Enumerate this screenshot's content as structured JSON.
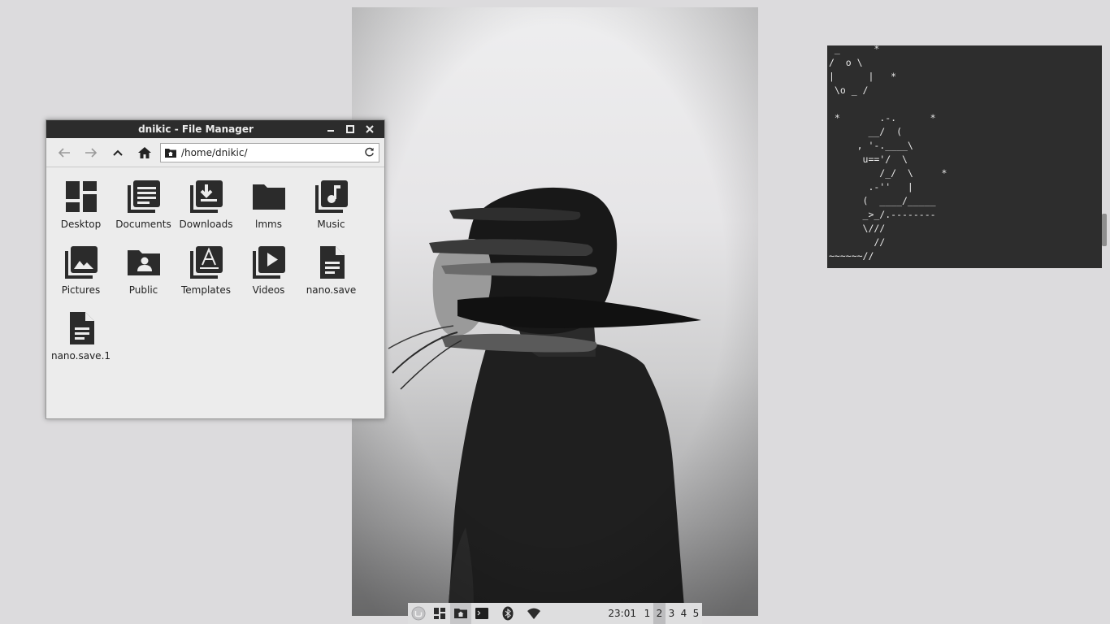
{
  "file_manager": {
    "title": "dnikic - File Manager",
    "path": "/home/dnikic/",
    "items": [
      {
        "label": "Desktop",
        "icon": "desktop-folder-icon"
      },
      {
        "label": "Documents",
        "icon": "documents-folder-icon"
      },
      {
        "label": "Downloads",
        "icon": "downloads-folder-icon"
      },
      {
        "label": "lmms",
        "icon": "folder-icon"
      },
      {
        "label": "Music",
        "icon": "music-folder-icon"
      },
      {
        "label": "Pictures",
        "icon": "pictures-folder-icon"
      },
      {
        "label": "Public",
        "icon": "public-folder-icon"
      },
      {
        "label": "Templates",
        "icon": "templates-folder-icon"
      },
      {
        "label": "Videos",
        "icon": "videos-folder-icon"
      },
      {
        "label": "nano.save",
        "icon": "text-file-icon"
      },
      {
        "label": "nano.save.1",
        "icon": "text-file-icon"
      }
    ]
  },
  "terminal": {
    "ascii_art": " _      *\n/  o \\\n|      |   *\n \\o _ /\n\n *       .-.      *\n       __/  (\n     , '-.____\\\n      u=='/  \\\n         /_/  \\     *\n       .-''   |\n      (  ____/_____\n      _>_/.--------\n      \\///\n        //\n~~~~~~//"
  },
  "taskbar": {
    "clock": "23:01",
    "workspaces": [
      "1",
      "2",
      "3",
      "4",
      "5"
    ],
    "active_workspace": "2"
  },
  "colors": {
    "desktop_bg": "#dcdbdd",
    "titlebar": "#2c2c2c",
    "terminal_bg": "#2d2d2d",
    "icon_fill": "#2b2b2b"
  }
}
